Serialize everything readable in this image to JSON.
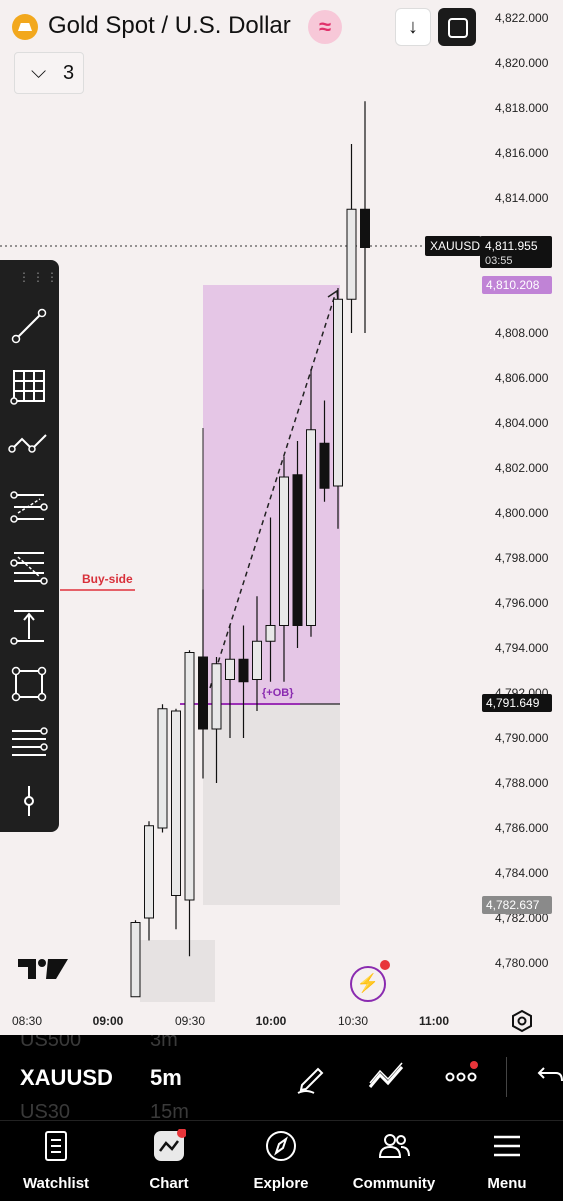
{
  "header": {
    "title": "Gold Spot / U.S. Dollar",
    "collapse_count": "3",
    "icons": [
      "gold-logo-icon",
      "wave-icon",
      "arrow-down-icon",
      "fullscreen-icon",
      "chevron-down-icon"
    ]
  },
  "chart_data": {
    "type": "candlestick",
    "symbol": "XAUUSD",
    "price_ticks": [
      "4,822.000",
      "4,820.000",
      "4,818.000",
      "4,816.000",
      "4,814.000",
      "4,812.000",
      "4,810.000",
      "4,808.000",
      "4,806.000",
      "4,804.000",
      "4,802.000",
      "4,800.000",
      "4,798.000",
      "4,796.000",
      "4,794.000",
      "4,792.000",
      "4,790.000",
      "4,788.000",
      "4,786.000",
      "4,784.000",
      "4,782.000",
      "4,780.000"
    ],
    "time_ticks": [
      "08:30",
      "09:00",
      "09:30",
      "10:00",
      "10:30",
      "11:00"
    ],
    "current_price": "4,811.955",
    "countdown": "03:55",
    "level_high": "4,810.208",
    "level_ob": "4,791.649",
    "level_low": "4,782.637",
    "annotations": {
      "buy_side": "Buy-side",
      "order_block": "{+OB}"
    },
    "candles": [
      {
        "o": 4778.5,
        "h": 4781.9,
        "l": 4778.5,
        "c": 4781.8
      },
      {
        "o": 4782.0,
        "h": 4786.3,
        "l": 4781.0,
        "c": 4786.1
      },
      {
        "o": 4786.0,
        "h": 4791.5,
        "l": 4785.8,
        "c": 4791.3
      },
      {
        "o": 4783.0,
        "h": 4791.3,
        "l": 4781.5,
        "c": 4791.2
      },
      {
        "o": 4782.8,
        "h": 4793.9,
        "l": 4780.3,
        "c": 4793.8
      },
      {
        "o": 4793.6,
        "h": 4796.6,
        "l": 4788.2,
        "c": 4790.4
      },
      {
        "o": 4790.4,
        "h": 4793.6,
        "l": 4788.0,
        "c": 4793.3
      },
      {
        "o": 4792.6,
        "h": 4795.0,
        "l": 4790.0,
        "c": 4793.5
      },
      {
        "o": 4793.5,
        "h": 4795.0,
        "l": 4790.0,
        "c": 4792.5
      },
      {
        "o": 4792.6,
        "h": 4796.3,
        "l": 4791.2,
        "c": 4794.3
      },
      {
        "o": 4794.3,
        "h": 4799.8,
        "l": 4792.5,
        "c": 4795.0
      },
      {
        "o": 4795.0,
        "h": 4802.5,
        "l": 4792.5,
        "c": 4801.6
      },
      {
        "o": 4801.7,
        "h": 4803.2,
        "l": 4794.0,
        "c": 4795.0
      },
      {
        "o": 4795.0,
        "h": 4806.4,
        "l": 4794.5,
        "c": 4803.7
      },
      {
        "o": 4803.1,
        "h": 4805.0,
        "l": 4800.5,
        "c": 4801.1
      },
      {
        "o": 4801.2,
        "h": 4810.0,
        "l": 4799.3,
        "c": 4809.5
      },
      {
        "o": 4809.5,
        "h": 4816.4,
        "l": 4808.0,
        "c": 4813.5
      },
      {
        "o": 4813.5,
        "h": 4818.3,
        "l": 4808.0,
        "c": 4811.8
      }
    ]
  },
  "toolbar": {
    "icons": [
      "trend-line-icon",
      "gann-grid-icon",
      "path-icon",
      "parallel-channel-icon",
      "fib-retracement-icon",
      "measure-icon",
      "rectangle-icon",
      "horizontal-lines-icon",
      "anchor-icon"
    ]
  },
  "bottom_bar": {
    "ghost_top_symbol": "US500",
    "ghost_top_tf": "3m",
    "symbol": "XAUUSD",
    "timeframe": "5m",
    "ghost_bottom_symbol": "US30",
    "ghost_bottom_tf": "15m"
  },
  "nav": [
    {
      "label": "Watchlist",
      "icon": "watchlist-icon"
    },
    {
      "label": "Chart",
      "icon": "chart-icon"
    },
    {
      "label": "Explore",
      "icon": "compass-icon"
    },
    {
      "label": "Community",
      "icon": "community-icon"
    },
    {
      "label": "Menu",
      "icon": "menu-icon"
    }
  ]
}
